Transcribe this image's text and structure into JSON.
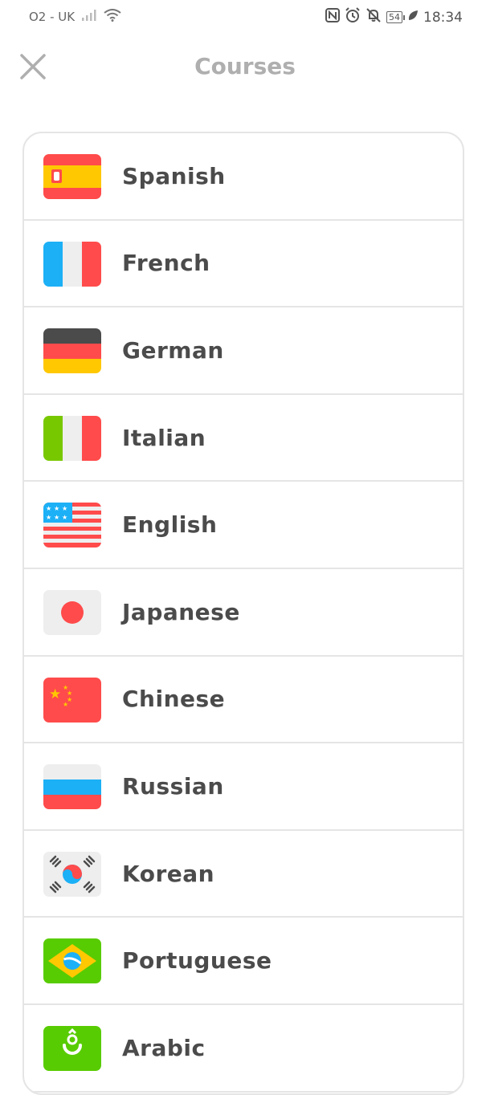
{
  "status_bar": {
    "carrier": "O2 - UK",
    "battery": "54",
    "time": "18:34"
  },
  "header": {
    "title": "Courses"
  },
  "courses": [
    {
      "name": "Spanish",
      "flag": "spain-flag-icon"
    },
    {
      "name": "French",
      "flag": "france-flag-icon"
    },
    {
      "name": "German",
      "flag": "germany-flag-icon"
    },
    {
      "name": "Italian",
      "flag": "italy-flag-icon"
    },
    {
      "name": "English",
      "flag": "usa-flag-icon"
    },
    {
      "name": "Japanese",
      "flag": "japan-flag-icon"
    },
    {
      "name": "Chinese",
      "flag": "china-flag-icon"
    },
    {
      "name": "Russian",
      "flag": "russia-flag-icon"
    },
    {
      "name": "Korean",
      "flag": "korea-flag-icon"
    },
    {
      "name": "Portuguese",
      "flag": "brazil-flag-icon"
    },
    {
      "name": "Arabic",
      "flag": "arabic-flag-icon"
    }
  ],
  "colors": {
    "title": "#afafaf",
    "text": "#4b4b4b",
    "border": "#e5e5e5"
  }
}
